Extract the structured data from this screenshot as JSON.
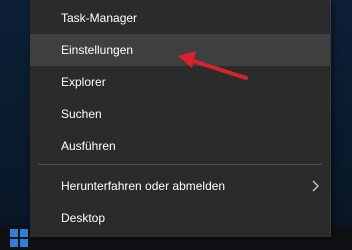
{
  "menu": {
    "items": [
      {
        "label": "Task-Manager"
      },
      {
        "label": "Einstellungen"
      },
      {
        "label": "Explorer"
      },
      {
        "label": "Suchen"
      },
      {
        "label": "Ausführen"
      },
      {
        "label": "Herunterfahren oder abmelden"
      },
      {
        "label": "Desktop"
      }
    ],
    "highlight_color": "#3f3f3f",
    "background_color": "#2b2b2b"
  },
  "icons": {
    "start": "windows-logo-icon",
    "submenu": "chevron-right-icon"
  },
  "annotation": {
    "arrow_color": "#d9232b"
  }
}
